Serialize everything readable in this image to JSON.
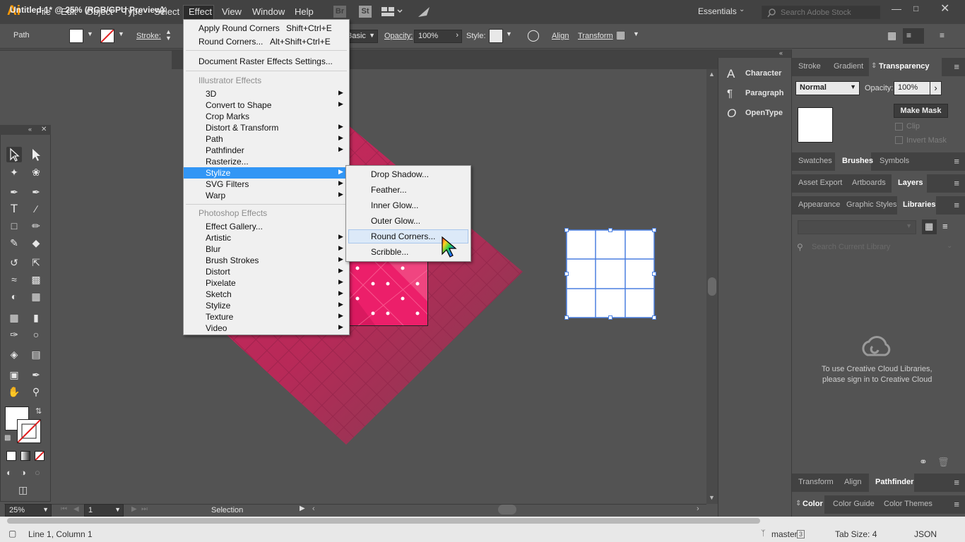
{
  "app": {
    "logo": "Ai"
  },
  "menubar": {
    "items": [
      "File",
      "Edit",
      "Object",
      "Type",
      "Select",
      "Effect",
      "View",
      "Window",
      "Help"
    ],
    "bridge_label": "Br",
    "stock_label": "St",
    "workspace": "Essentials",
    "stock_search_placeholder": "Search Adobe Stock"
  },
  "controlbar": {
    "selection_type": "Path",
    "stroke_label": "Stroke:",
    "style_preset": "Basic",
    "opacity_label": "Opacity:",
    "opacity_value": "100%",
    "style_label": "Style:",
    "align_label": "Align",
    "transform_label": "Transform"
  },
  "document": {
    "tab_title": "Untitled-1* @ 25% (RGB/GPU Preview)",
    "zoom": "25%",
    "artboard": "1",
    "status_tool": "Selection"
  },
  "effect_menu": {
    "apply_last": {
      "label": "Apply Round Corners",
      "shortcut": "Shift+Ctrl+E"
    },
    "last": {
      "label": "Round Corners...",
      "shortcut": "Alt+Shift+Ctrl+E"
    },
    "raster_settings": "Document Raster Effects Settings...",
    "illustrator_header": "Illustrator Effects",
    "illustrator_items": [
      "3D",
      "Convert to Shape",
      "Crop Marks",
      "Distort & Transform",
      "Path",
      "Pathfinder",
      "Rasterize...",
      "Stylize",
      "SVG Filters",
      "Warp"
    ],
    "photoshop_header": "Photoshop Effects",
    "photoshop_items": [
      "Effect Gallery...",
      "Artistic",
      "Blur",
      "Brush Strokes",
      "Distort",
      "Pixelate",
      "Sketch",
      "Stylize",
      "Texture",
      "Video"
    ]
  },
  "stylize_menu": {
    "items": [
      "Drop Shadow...",
      "Feather...",
      "Inner Glow...",
      "Outer Glow...",
      "Round Corners...",
      "Scribble..."
    ],
    "hovered": "Round Corners..."
  },
  "dock": {
    "items": [
      "Character",
      "Paragraph",
      "OpenType"
    ]
  },
  "panels": {
    "row1_tabs": [
      "Stroke",
      "Gradient",
      "Transparency"
    ],
    "blend_mode": "Normal",
    "opacity_label": "Opacity:",
    "opacity_value": "100%",
    "make_mask": "Make Mask",
    "clip": "Clip",
    "invert_mask": "Invert Mask",
    "row2_tabs": [
      "Swatches",
      "Brushes",
      "Symbols"
    ],
    "row3_tabs": [
      "Asset Export",
      "Artboards",
      "Layers"
    ],
    "row4_tabs": [
      "Appearance",
      "Graphic Styles",
      "Libraries"
    ],
    "library_search_placeholder": "Search Current Library",
    "cc_message_line1": "To use Creative Cloud Libraries,",
    "cc_message_line2": "please sign in to Creative Cloud",
    "row5_tabs": [
      "Transform",
      "Align",
      "Pathfinder"
    ],
    "row6_tabs": [
      "Color",
      "Color Guide",
      "Color Themes"
    ]
  },
  "editor_status": {
    "position": "Line 1, Column 1",
    "branch": "master",
    "branch_count": "3",
    "tab_size": "Tab Size: 4",
    "language": "JSON"
  },
  "colors": {
    "accent": "#ff9a00",
    "menu_highlight": "#3296f5",
    "artwork_pink": "#e8195c",
    "selection_blue": "#4a7fe0"
  }
}
